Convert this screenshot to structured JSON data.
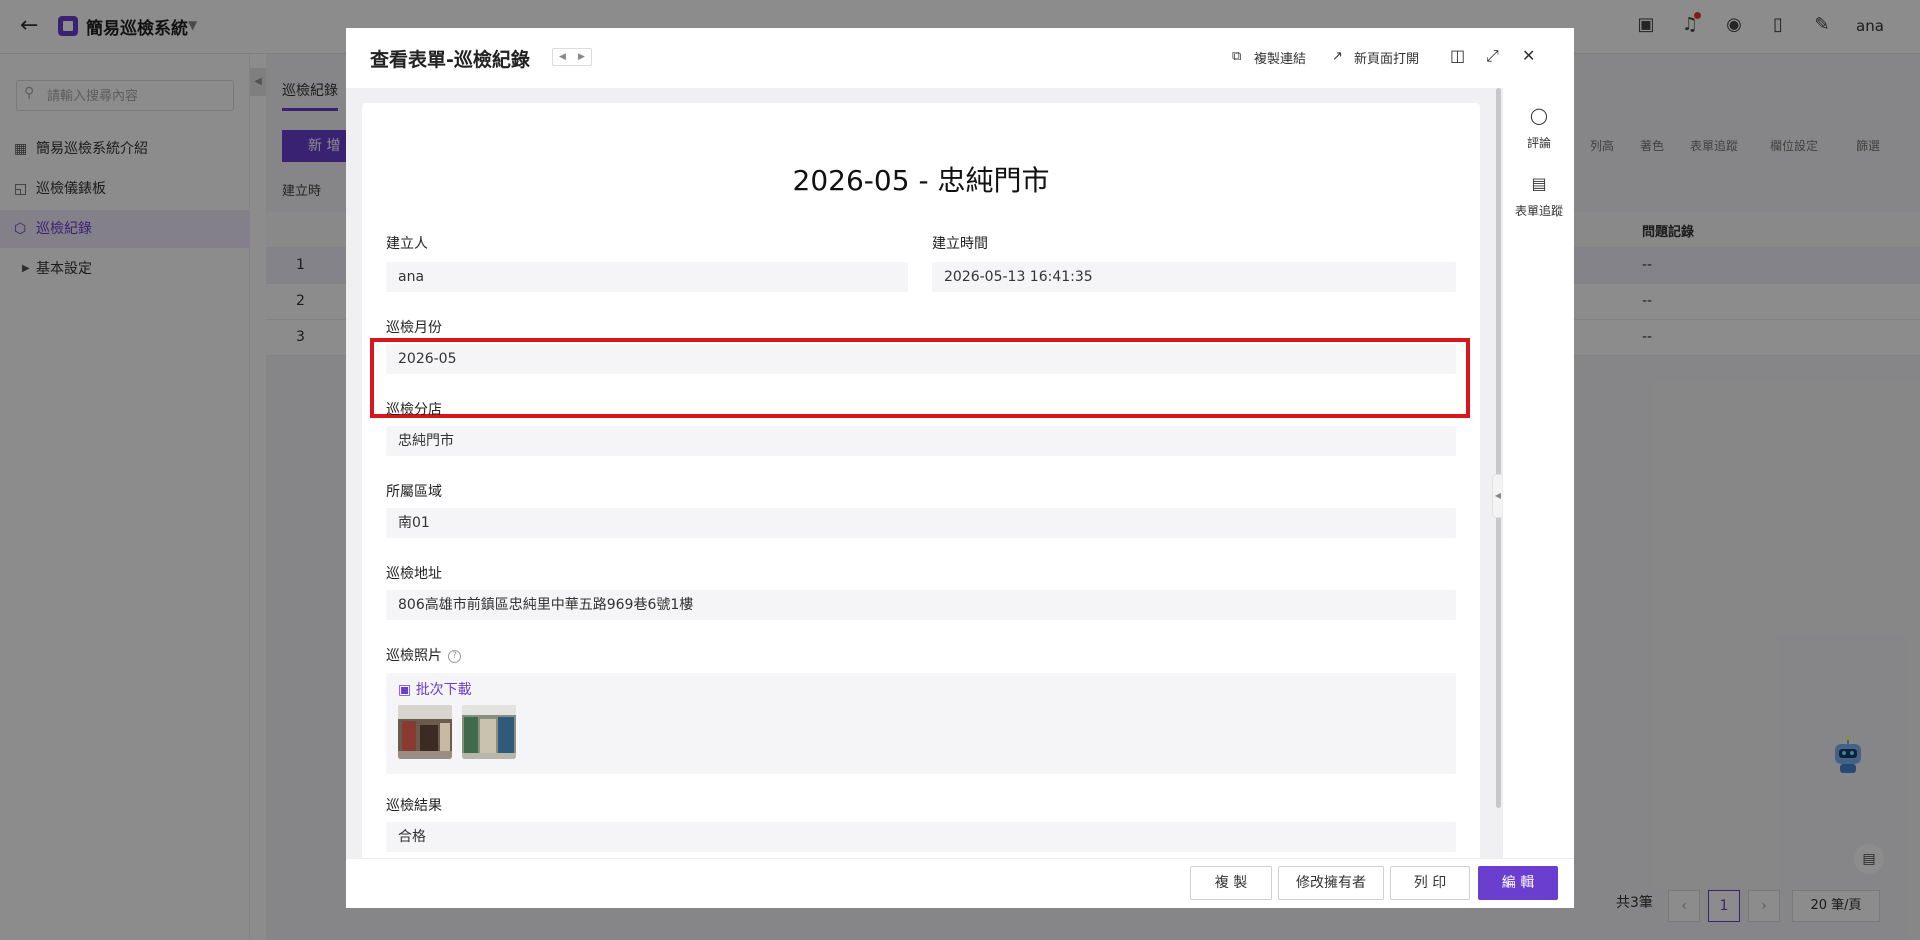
{
  "app": {
    "name": "簡易巡檢系統",
    "user": "ana"
  },
  "sidebar": {
    "search_placeholder": "請輸入搜尋內容",
    "items": [
      {
        "label": "簡易巡檢系統介紹"
      },
      {
        "label": "巡檢儀錶板"
      },
      {
        "label": "巡檢紀錄"
      },
      {
        "label": "基本設定"
      }
    ]
  },
  "background": {
    "tab": "巡檢紀錄",
    "new_button": "新 增",
    "filter_chip": "建立時",
    "row_numbers": [
      "1",
      "2",
      "3"
    ],
    "col_issue": "問題記錄",
    "issue_values": [
      "--",
      "--",
      "--"
    ],
    "toolbar": [
      "列高",
      "著色",
      "表單追蹤",
      "欄位設定",
      "篩選"
    ],
    "pagination": {
      "total": "共3筆",
      "current": "1",
      "page_size": "20 筆/頁"
    }
  },
  "modal": {
    "title": "查看表單-巡檢紀錄",
    "actions": {
      "copy_link": "複製連結",
      "open_new": "新頁面打開"
    },
    "form_title": "2026-05 - 忠純門市",
    "fields": {
      "creator": {
        "label": "建立人",
        "value": "ana"
      },
      "created_at": {
        "label": "建立時間",
        "value": "2026-05-13 16:41:35"
      },
      "month": {
        "label": "巡檢月份",
        "value": "2026-05"
      },
      "branch": {
        "label": "巡檢分店",
        "value": "忠純門市"
      },
      "region": {
        "label": "所屬區域",
        "value": "南01"
      },
      "address": {
        "label": "巡檢地址",
        "value": "806高雄市前鎮區忠純里中華五路969巷6號1樓"
      },
      "photos": {
        "label": "巡檢照片",
        "bulk_download": "批次下載"
      },
      "result": {
        "label": "巡檢結果",
        "value": "合格"
      }
    },
    "side_panel": {
      "comment": "評論",
      "tracking": "表單追蹤"
    },
    "footer": {
      "copy": "複 製",
      "change_owner": "修改擁有者",
      "print": "列 印",
      "edit": "編 輯"
    }
  },
  "colors": {
    "accent": "#6a3fd0",
    "highlight_border": "#d9161c",
    "overlay": "rgba(0,0,0,0.45)"
  }
}
